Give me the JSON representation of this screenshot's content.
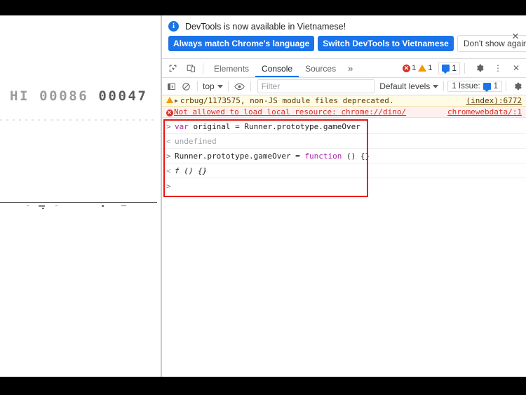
{
  "game": {
    "hi_label": "HI",
    "hi_score": "00086",
    "current_score": "00047"
  },
  "devtools": {
    "notification": {
      "icon": "info-icon",
      "message": "DevTools is now available in Vietnamese!",
      "primary_button": "Always match Chrome's language",
      "secondary_button": "Switch DevTools to Vietnamese",
      "dismiss_button": "Don't show again",
      "close_icon": "✕"
    },
    "tabbar": {
      "inspect_icon": "inspect-element-icon",
      "device_icon": "device-toolbar-icon",
      "tabs": [
        {
          "label": "Elements",
          "active": false
        },
        {
          "label": "Console",
          "active": true
        },
        {
          "label": "Sources",
          "active": false
        }
      ],
      "more_tabs_icon": "»",
      "error_count": "1",
      "warning_count": "1",
      "message_count": "1",
      "settings_icon": "gear-icon",
      "menu_icon": "⋮",
      "close_icon": "✕"
    },
    "filterbar": {
      "sidebar_toggle_icon": "console-sidebar-icon",
      "clear_icon": "clear-console-icon",
      "context_selector": "top",
      "eye_icon": "live-expression-icon",
      "filter_placeholder": "Filter",
      "filter_value": "",
      "levels_selector": "Default levels",
      "issues_label": "1 Issue:",
      "issues_count": "1",
      "settings_icon": "gear-icon"
    },
    "console_messages": [
      {
        "type": "warning",
        "icon": "warning-triangle-icon",
        "expand_arrow": "▶",
        "text": "crbug/1173575, non-JS module files deprecated.",
        "source": "(index):6772"
      },
      {
        "type": "error",
        "icon": "error-circle-icon",
        "text": "Not allowed to load local resource: chrome://dino/",
        "source": "chromewebdata/:1"
      }
    ],
    "console_entries": [
      {
        "gutter": ">",
        "kind": "input",
        "tokens": [
          {
            "text": "var",
            "style": "kw"
          },
          {
            "text": " original = Runner.prototype.gameOver",
            "style": "plain"
          }
        ]
      },
      {
        "gutter": "<",
        "kind": "output",
        "tokens": [
          {
            "text": "undefined",
            "style": "muted"
          }
        ]
      },
      {
        "gutter": ">",
        "kind": "input",
        "tokens": [
          {
            "text": "Runner.prototype.gameOver = ",
            "style": "plain"
          },
          {
            "text": "function",
            "style": "kw"
          },
          {
            "text": " () {}",
            "style": "plain"
          }
        ]
      },
      {
        "gutter": "<",
        "kind": "output",
        "tokens": [
          {
            "text": "f () {}",
            "style": "italic"
          }
        ]
      },
      {
        "gutter": ">",
        "kind": "prompt",
        "tokens": []
      }
    ],
    "annotation": {
      "name": "red-highlight-rectangle",
      "color": "#ee1111"
    }
  },
  "colors": {
    "accent_blue": "#1a73e8",
    "error_red": "#d93025",
    "warning_orange": "#f29900",
    "annotation_red": "#ee1111",
    "dino_ground": "#535353",
    "score_hi": "#9b9b9b",
    "score_current": "#5a5a5a"
  }
}
